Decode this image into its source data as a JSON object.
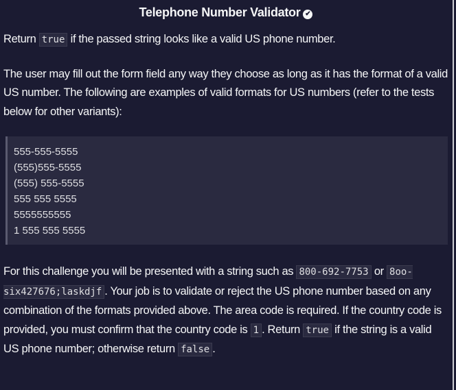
{
  "title": "Telephone Number Validator",
  "icons": {
    "completed": "check-circle-icon"
  },
  "p1": [
    "Return ",
    "true",
    " if the passed string looks like a valid US phone number."
  ],
  "p2": "The user may fill out the form field any way they choose as long as it has the format of a valid US number. The following are examples of valid formats for US numbers (refer to the tests below for other variants):",
  "examples": [
    "555-555-5555",
    "(555)555-5555",
    "(555) 555-5555",
    "555 555 5555",
    "5555555555",
    "1 555 555 5555"
  ],
  "p3": {
    "t1": "For this challenge you will be presented with a string such as ",
    "c1": "800-692-7753",
    "t2": " or ",
    "c2": "8oo-six427676;laskdjf",
    "t3": ". Your job is to validate or reject the US phone number based on any combination of the formats provided above. The area code is required. If the country code is provided, you must confirm that the country code is ",
    "c3": "1",
    "t4": ". Return ",
    "c4": "true",
    "t5": " if the string is a valid US phone number; otherwise return ",
    "c5": "false",
    "t6": "."
  }
}
